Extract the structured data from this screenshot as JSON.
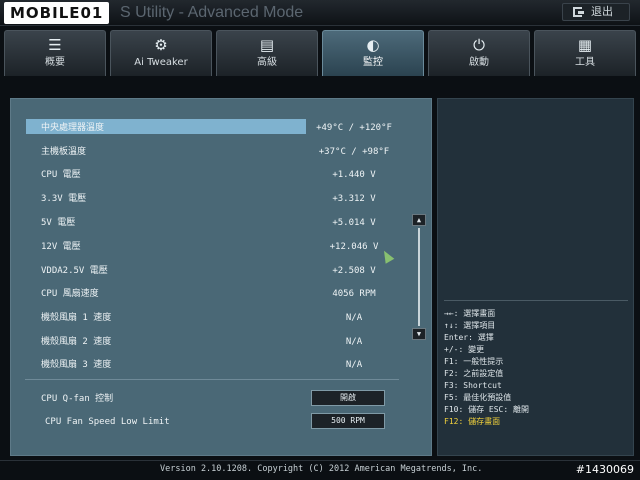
{
  "header": {
    "logo": "MOBILE01",
    "title": "S Utility - Advanced Mode",
    "exit_label": "退出"
  },
  "tabs": [
    {
      "label": "概要",
      "icon": "list-icon",
      "glyph": "☰"
    },
    {
      "label": "Ai Tweaker",
      "icon": "tweaker-icon",
      "glyph": "⚙"
    },
    {
      "label": "高級",
      "icon": "advanced-icon",
      "glyph": "▤"
    },
    {
      "label": "監控",
      "icon": "monitor-icon",
      "glyph": "◐",
      "active": true
    },
    {
      "label": "啟動",
      "icon": "power-icon",
      "glyph": "⏻"
    },
    {
      "label": "工具",
      "icon": "tools-icon",
      "glyph": "▦"
    }
  ],
  "monitor": {
    "rows": [
      {
        "label": "中央處理器溫度",
        "value": "+49°C / +120°F"
      },
      {
        "label": "主機板溫度",
        "value": "+37°C / +98°F"
      },
      {
        "label": "CPU 電壓",
        "value": "+1.440 V"
      },
      {
        "label": "3.3V 電壓",
        "value": "+3.312 V"
      },
      {
        "label": "5V 電壓",
        "value": "+5.014 V"
      },
      {
        "label": "12V 電壓",
        "value": "+12.046 V"
      },
      {
        "label": "VDDA2.5V 電壓",
        "value": "+2.508 V"
      },
      {
        "label": "CPU 風扇速度",
        "value": "4056 RPM"
      },
      {
        "label": "機殼風扇 1 速度",
        "value": "N/A"
      },
      {
        "label": "機殼風扇 2 速度",
        "value": "N/A"
      },
      {
        "label": "機殼風扇 3 速度",
        "value": "N/A"
      }
    ],
    "qfan_label": "CPU Q-fan 控制",
    "qfan_value": "開啟",
    "fan_low_label": "CPU Fan Speed Low Limit",
    "fan_low_value": "500 RPM"
  },
  "help": [
    "→←: 選擇畫面",
    "↑↓: 選擇項目",
    "Enter: 選擇",
    "+/-: 變更",
    "F1: 一般性提示",
    "F2: 之前設定值",
    "F3: Shortcut",
    "F5: 最佳化預設值",
    "F10: 儲存  ESC: 離開",
    "F12: 儲存畫面"
  ],
  "footer": {
    "version": "Version 2.10.1208. Copyright (C) 2012 American Megatrends, Inc.",
    "watermark": "#1430069"
  }
}
